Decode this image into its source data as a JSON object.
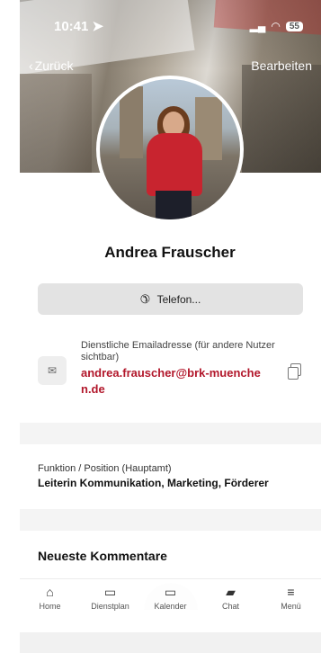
{
  "status_bar": {
    "time": "10:41",
    "battery": "55"
  },
  "nav": {
    "back_label": "Zurück",
    "edit_label": "Bearbeiten"
  },
  "profile": {
    "name": "Andrea Frauscher"
  },
  "phone_button": {
    "label": "Telefon..."
  },
  "email": {
    "label": "Dienstliche Emailadresse (für andere Nutzer sichtbar)",
    "value": "andrea.frauscher@brk-muenchen.de"
  },
  "function": {
    "label": "Funktion / Position (Hauptamt)",
    "value": "Leiterin Kommunikation, Marketing, Förderer"
  },
  "comments": {
    "title": "Neueste Kommentare"
  },
  "tabbar": {
    "items": [
      {
        "label": "Home",
        "icon": "home-icon"
      },
      {
        "label": "Dienstplan",
        "icon": "calendar-icon"
      },
      {
        "label": "Kalender",
        "icon": "calendar-icon"
      },
      {
        "label": "Chat",
        "icon": "chat-icon"
      },
      {
        "label": "Menü",
        "icon": "menu-icon"
      }
    ]
  },
  "colors": {
    "accent_red": "#b2172b",
    "button_gray": "#e3e3e3"
  }
}
